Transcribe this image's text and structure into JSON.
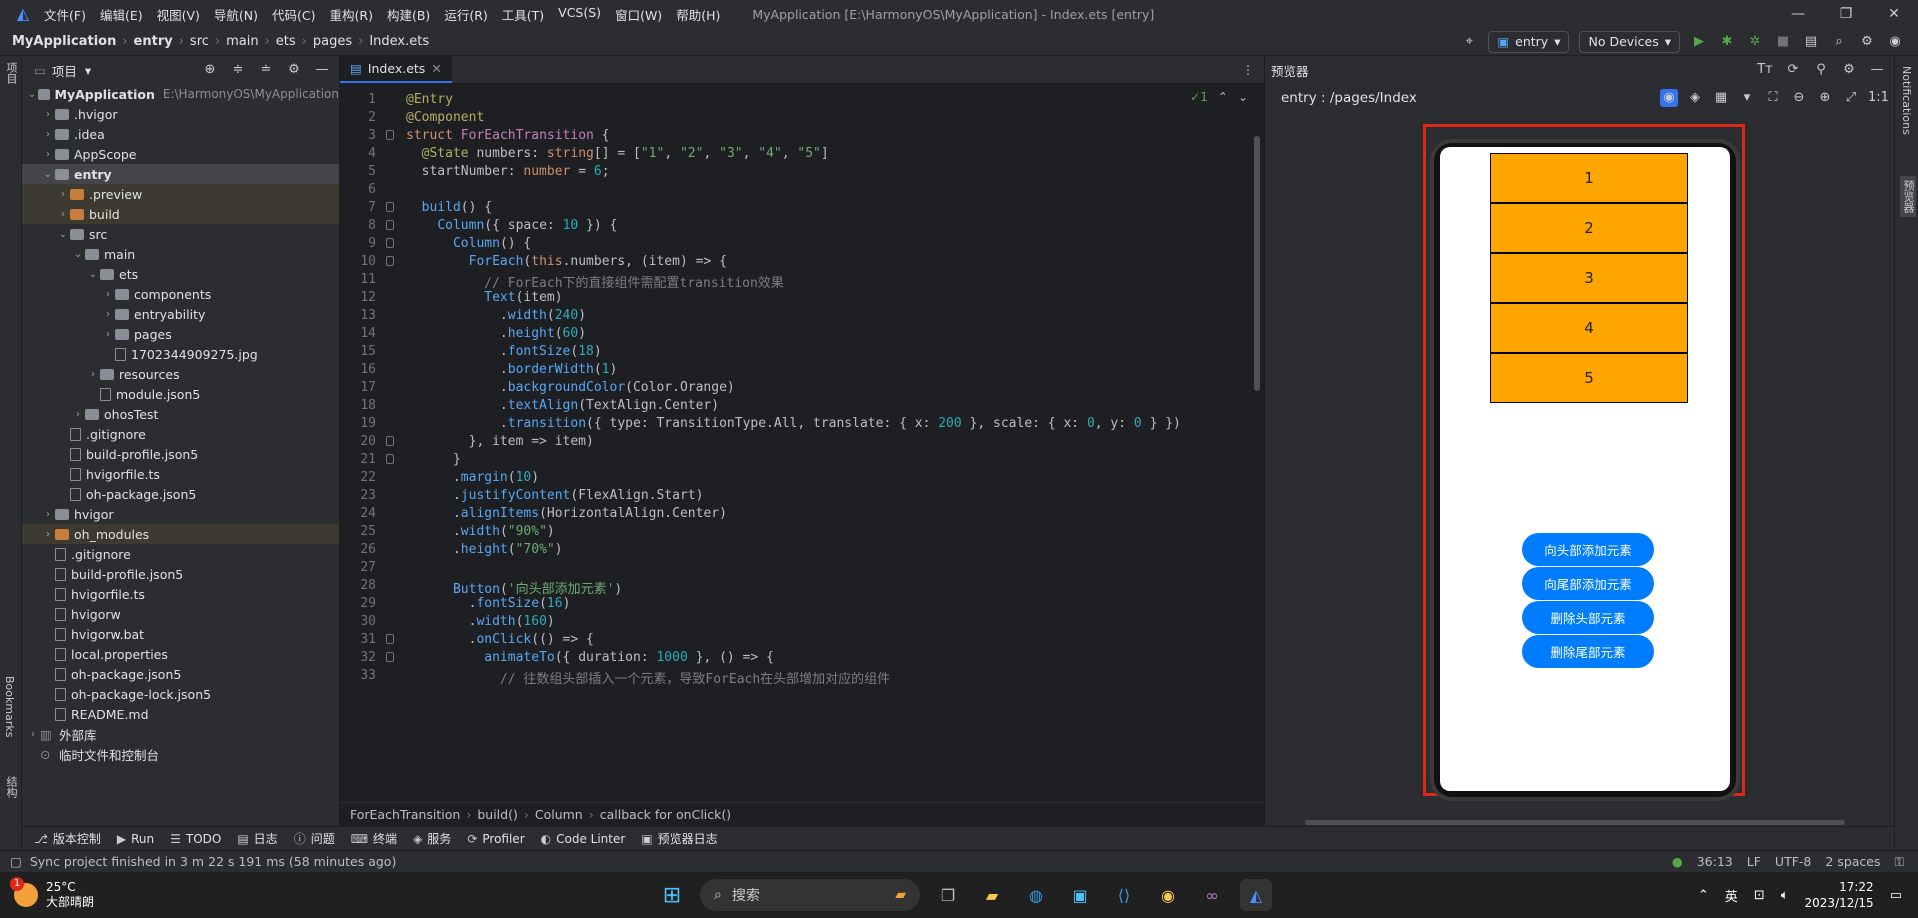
{
  "titlebar": {
    "menus": [
      "文件(F)",
      "编辑(E)",
      "视图(V)",
      "导航(N)",
      "代码(C)",
      "重构(R)",
      "构建(B)",
      "运行(R)",
      "工具(T)",
      "VCS(S)",
      "窗口(W)",
      "帮助(H)"
    ],
    "title": "MyApplication [E:\\HarmonyOS\\MyApplication] - Index.ets [entry]"
  },
  "navbar": {
    "crumbs": [
      "MyApplication",
      "entry",
      "src",
      "main",
      "ets",
      "pages",
      "Index.ets"
    ],
    "module": "entry",
    "device": "No Devices"
  },
  "leftstrip": {
    "project": "项目",
    "bookmarks": "Bookmarks",
    "structure": "结构"
  },
  "project": {
    "header": "项目",
    "tree": [
      {
        "label": "MyApplication",
        "path": "E:\\HarmonyOS\\MyApplication",
        "depth": 0,
        "type": "folder",
        "open": true
      },
      {
        "label": ".hvigor",
        "depth": 1,
        "type": "folder"
      },
      {
        "label": ".idea",
        "depth": 1,
        "type": "folder"
      },
      {
        "label": "AppScope",
        "depth": 1,
        "type": "folder"
      },
      {
        "label": "entry",
        "depth": 1,
        "type": "folder",
        "open": true,
        "selected": true
      },
      {
        "label": ".preview",
        "depth": 2,
        "type": "folder-o",
        "hl": true
      },
      {
        "label": "build",
        "depth": 2,
        "type": "folder-o",
        "hl": true
      },
      {
        "label": "src",
        "depth": 2,
        "type": "folder",
        "open": true
      },
      {
        "label": "main",
        "depth": 3,
        "type": "folder",
        "open": true
      },
      {
        "label": "ets",
        "depth": 4,
        "type": "folder",
        "open": true
      },
      {
        "label": "components",
        "depth": 5,
        "type": "folder"
      },
      {
        "label": "entryability",
        "depth": 5,
        "type": "folder"
      },
      {
        "label": "pages",
        "depth": 5,
        "type": "folder"
      },
      {
        "label": "1702344909275.jpg",
        "depth": 5,
        "type": "file",
        "leaf": true
      },
      {
        "label": "resources",
        "depth": 4,
        "type": "folder"
      },
      {
        "label": "module.json5",
        "depth": 4,
        "type": "file",
        "leaf": true
      },
      {
        "label": "ohosTest",
        "depth": 3,
        "type": "folder"
      },
      {
        "label": ".gitignore",
        "depth": 2,
        "type": "file",
        "leaf": true
      },
      {
        "label": "build-profile.json5",
        "depth": 2,
        "type": "file",
        "leaf": true
      },
      {
        "label": "hvigorfile.ts",
        "depth": 2,
        "type": "file",
        "leaf": true
      },
      {
        "label": "oh-package.json5",
        "depth": 2,
        "type": "file",
        "leaf": true
      },
      {
        "label": "hvigor",
        "depth": 1,
        "type": "folder"
      },
      {
        "label": "oh_modules",
        "depth": 1,
        "type": "folder-o",
        "hl": true
      },
      {
        "label": ".gitignore",
        "depth": 1,
        "type": "file",
        "leaf": true
      },
      {
        "label": "build-profile.json5",
        "depth": 1,
        "type": "file",
        "leaf": true
      },
      {
        "label": "hvigorfile.ts",
        "depth": 1,
        "type": "file",
        "leaf": true
      },
      {
        "label": "hvigorw",
        "depth": 1,
        "type": "file",
        "leaf": true
      },
      {
        "label": "hvigorw.bat",
        "depth": 1,
        "type": "file",
        "leaf": true
      },
      {
        "label": "local.properties",
        "depth": 1,
        "type": "file",
        "leaf": true
      },
      {
        "label": "oh-package.json5",
        "depth": 1,
        "type": "file",
        "leaf": true
      },
      {
        "label": "oh-package-lock.json5",
        "depth": 1,
        "type": "file",
        "leaf": true
      },
      {
        "label": "README.md",
        "depth": 1,
        "type": "file",
        "leaf": true
      },
      {
        "label": "外部库",
        "depth": 0,
        "type": "lib"
      },
      {
        "label": "临时文件和控制台",
        "depth": 0,
        "type": "scratch",
        "leaf": true
      }
    ]
  },
  "editor": {
    "tab": "Index.ets",
    "inspection": "✓1",
    "lines": [
      [
        [
          "an",
          "@Entry"
        ]
      ],
      [
        [
          "an",
          "@Component"
        ]
      ],
      [
        [
          "kw",
          "struct "
        ],
        [
          "ty",
          "ForEachTransition"
        ],
        [
          "prop",
          " {"
        ]
      ],
      [
        [
          "prop",
          "  "
        ],
        [
          "an",
          "@State"
        ],
        [
          "prop",
          " numbers: "
        ],
        [
          "kw",
          "string"
        ],
        [
          "prop",
          "[] = ["
        ],
        [
          "st",
          "\"1\""
        ],
        [
          "prop",
          ", "
        ],
        [
          "st",
          "\"2\""
        ],
        [
          "prop",
          ", "
        ],
        [
          "st",
          "\"3\""
        ],
        [
          "prop",
          ", "
        ],
        [
          "st",
          "\"4\""
        ],
        [
          "prop",
          ", "
        ],
        [
          "st",
          "\"5\""
        ],
        [
          "prop",
          "]"
        ]
      ],
      [
        [
          "prop",
          "  startNumber: "
        ],
        [
          "kw",
          "number"
        ],
        [
          "prop",
          " = "
        ],
        [
          "nu",
          "6"
        ],
        [
          "prop",
          ";"
        ]
      ],
      [
        [
          "prop",
          ""
        ]
      ],
      [
        [
          "prop",
          "  "
        ],
        [
          "fn",
          "build"
        ],
        [
          "prop",
          "() {"
        ]
      ],
      [
        [
          "prop",
          "    "
        ],
        [
          "fn",
          "Column"
        ],
        [
          "prop",
          "({ space: "
        ],
        [
          "nu",
          "10"
        ],
        [
          "prop",
          " }) {"
        ]
      ],
      [
        [
          "prop",
          "      "
        ],
        [
          "fn",
          "Column"
        ],
        [
          "prop",
          "() {"
        ]
      ],
      [
        [
          "prop",
          "        "
        ],
        [
          "fn",
          "ForEach"
        ],
        [
          "prop",
          "("
        ],
        [
          "kw",
          "this"
        ],
        [
          "prop",
          ".numbers, (item) => {"
        ]
      ],
      [
        [
          "cm",
          "          // ForEach下的直接组件需配置transition效果"
        ]
      ],
      [
        [
          "prop",
          "          "
        ],
        [
          "fn",
          "Text"
        ],
        [
          "prop",
          "(item)"
        ]
      ],
      [
        [
          "prop",
          "            ."
        ],
        [
          "fn",
          "width"
        ],
        [
          "prop",
          "("
        ],
        [
          "nu",
          "240"
        ],
        [
          "prop",
          ")"
        ]
      ],
      [
        [
          "prop",
          "            ."
        ],
        [
          "fn",
          "height"
        ],
        [
          "prop",
          "("
        ],
        [
          "nu",
          "60"
        ],
        [
          "prop",
          ")"
        ]
      ],
      [
        [
          "prop",
          "            ."
        ],
        [
          "fn",
          "fontSize"
        ],
        [
          "prop",
          "("
        ],
        [
          "nu",
          "18"
        ],
        [
          "prop",
          ")"
        ]
      ],
      [
        [
          "prop",
          "            ."
        ],
        [
          "fn",
          "borderWidth"
        ],
        [
          "prop",
          "("
        ],
        [
          "nu",
          "1"
        ],
        [
          "prop",
          ")"
        ]
      ],
      [
        [
          "prop",
          "            ."
        ],
        [
          "fn",
          "backgroundColor"
        ],
        [
          "prop",
          "(Color.Orange)"
        ]
      ],
      [
        [
          "prop",
          "            ."
        ],
        [
          "fn",
          "textAlign"
        ],
        [
          "prop",
          "(TextAlign.Center)"
        ]
      ],
      [
        [
          "prop",
          "            ."
        ],
        [
          "fn",
          "transition"
        ],
        [
          "prop",
          "({ type: TransitionType.All, translate: { x: "
        ],
        [
          "nu",
          "200"
        ],
        [
          "prop",
          " }, scale: { x: "
        ],
        [
          "nu",
          "0"
        ],
        [
          "prop",
          ", y: "
        ],
        [
          "nu",
          "0"
        ],
        [
          "prop",
          " } })"
        ]
      ],
      [
        [
          "prop",
          "        }, item => item)"
        ]
      ],
      [
        [
          "prop",
          "      }"
        ]
      ],
      [
        [
          "prop",
          "      ."
        ],
        [
          "fn",
          "margin"
        ],
        [
          "prop",
          "("
        ],
        [
          "nu",
          "10"
        ],
        [
          "prop",
          ")"
        ]
      ],
      [
        [
          "prop",
          "      ."
        ],
        [
          "fn",
          "justifyContent"
        ],
        [
          "prop",
          "(FlexAlign.Start)"
        ]
      ],
      [
        [
          "prop",
          "      ."
        ],
        [
          "fn",
          "alignItems"
        ],
        [
          "prop",
          "(HorizontalAlign.Center)"
        ]
      ],
      [
        [
          "prop",
          "      ."
        ],
        [
          "fn",
          "width"
        ],
        [
          "prop",
          "("
        ],
        [
          "st",
          "\"90%\""
        ],
        [
          "prop",
          ")"
        ]
      ],
      [
        [
          "prop",
          "      ."
        ],
        [
          "fn",
          "height"
        ],
        [
          "prop",
          "("
        ],
        [
          "st",
          "\"70%\""
        ],
        [
          "prop",
          ")"
        ]
      ],
      [
        [
          "prop",
          ""
        ]
      ],
      [
        [
          "prop",
          "      "
        ],
        [
          "fn",
          "Button"
        ],
        [
          "prop",
          "("
        ],
        [
          "st",
          "'向头部添加元素'"
        ],
        [
          "prop",
          ")"
        ]
      ],
      [
        [
          "prop",
          "        ."
        ],
        [
          "fn",
          "fontSize"
        ],
        [
          "prop",
          "("
        ],
        [
          "nu",
          "16"
        ],
        [
          "prop",
          ")"
        ]
      ],
      [
        [
          "prop",
          "        ."
        ],
        [
          "fn",
          "width"
        ],
        [
          "prop",
          "("
        ],
        [
          "nu",
          "160"
        ],
        [
          "prop",
          ")"
        ]
      ],
      [
        [
          "prop",
          "        ."
        ],
        [
          "fn",
          "onClick"
        ],
        [
          "prop",
          "(() => {"
        ]
      ],
      [
        [
          "prop",
          "          "
        ],
        [
          "fn",
          "animateTo"
        ],
        [
          "prop",
          "({ duration: "
        ],
        [
          "nu",
          "1000"
        ],
        [
          "prop",
          " }, () => {"
        ]
      ],
      [
        [
          "cm",
          "            // 往数组头部插入一个元素，导致ForEach在头部增加对应的组件"
        ]
      ]
    ],
    "breadcrumb": [
      "ForEachTransition",
      "build()",
      "Column",
      "callback for onClick()"
    ]
  },
  "preview": {
    "header": "预览器",
    "path": "entry : /pages/Index",
    "items": [
      "1",
      "2",
      "3",
      "4",
      "5"
    ],
    "buttons": [
      "向头部添加元素",
      "向尾部添加元素",
      "删除头部元素",
      "删除尾部元素"
    ]
  },
  "rightstrip": {
    "notifications": "Notifications",
    "previewer": "预览器"
  },
  "toolwindows": [
    "版本控制",
    "Run",
    "TODO",
    "日志",
    "问题",
    "终端",
    "服务",
    "Profiler",
    "Code Linter",
    "预览器日志"
  ],
  "status": {
    "message": "Sync project finished in 3 m 22 s 191 ms (58 minutes ago)",
    "position": "36:13",
    "lineSep": "LF",
    "encoding": "UTF-8",
    "indent": "2 spaces"
  },
  "taskbar": {
    "badge": "1",
    "temp": "25°C",
    "weather": "大部晴朗",
    "search": "搜索",
    "ime": "英",
    "time": "17:22",
    "date": "2023/12/15"
  }
}
